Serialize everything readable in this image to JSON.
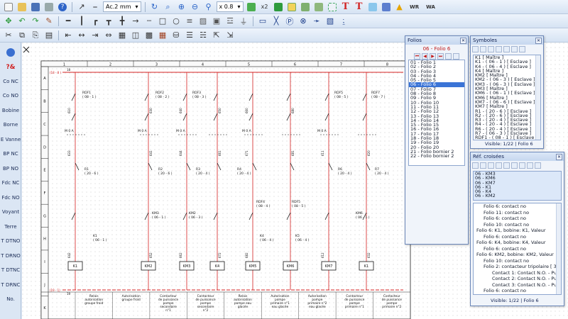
{
  "toolbar": {
    "line_style": "Ac.2 mm",
    "zoom": "x 0.8",
    "wr_badge": "WR",
    "wa_badge": "WA",
    "x2_label": "x2",
    "icons": [
      "new-icon",
      "open-icon",
      "save-icon",
      "print-icon",
      "help-icon",
      "pointer-icon",
      "cross-icon",
      "zoom-icon",
      "text-T-icon",
      "component-icon",
      "wire-icon"
    ]
  },
  "palette": {
    "items": [
      "?&",
      "Co NC",
      "Co NO",
      "Bobine",
      "Borne",
      "E Vanne",
      "BP NC",
      "BP NO",
      "Fdc NC",
      "Fdc NO",
      "Voyant",
      "Terre",
      "T DTNO",
      "T DRNO",
      "T DTNC",
      "T DRNC",
      "No."
    ]
  },
  "schematic": {
    "columns": [
      "1",
      "2",
      "3",
      "4",
      "5",
      "6",
      "7",
      "8"
    ],
    "rows": [
      "A",
      "B",
      "C",
      "D",
      "E",
      "F",
      "G",
      "H",
      "I",
      "J",
      "K"
    ],
    "top_feed": "(18 - 8 )",
    "bottom_feed": "(19 - 1)",
    "wire_top": "18",
    "wire_bottom": "19",
    "moa": [
      "M 0 A",
      "M 0 A",
      "M 0 A",
      "M 0 A",
      "M 0 A"
    ],
    "rdf": [
      "RDF1",
      "( 08 - 1 )",
      "RDF2",
      "( 08 - 2 )",
      "RDF3",
      "( 08 - 3 )",
      "RDF5",
      "( 08 - 5 )",
      "RDF7",
      "( 08 - 7 )"
    ],
    "relays": [
      "R1",
      "( 20 - 6 )",
      "R2",
      "( 20 - 6 )",
      "R3",
      "( 20 - 4 )",
      "R4",
      "( 20 - 4 )",
      "R6",
      "( 20 - 4 )",
      "R7",
      "( 20 - 4 )"
    ],
    "contactors": [
      "KM3",
      "( 06 - 1 )",
      "KM2",
      "( 06 - 3 )",
      "KM6",
      "( 06 - 1 )",
      "K1",
      "( 06 - 1 )",
      "K4",
      "( 06 - 4 )",
      "K5",
      "( 06 - 4 )",
      "RDF4",
      "( 08 - 4 )",
      "RDF5",
      "( 08 - 5 )"
    ],
    "coils": [
      "K1",
      "KM2",
      "KM3",
      "K4",
      "KM5",
      "KM6",
      "KM7"
    ],
    "wire_numbers": [
      "610",
      "630",
      "640",
      "650",
      "660",
      "680",
      "611",
      "620",
      "633",
      "641",
      "644",
      "661",
      "671",
      "681",
      "612",
      "632",
      "642",
      "652",
      "662",
      "672",
      "682"
    ],
    "captions": [
      "Relais autorisation groupe froid",
      "Autorisation groupe froid",
      "Contacteur de puissance pompe secondaire n°1",
      "Contacteur de puissance pompe secondaire n°2",
      "Relais autorisation pompe eau glacée",
      "Autorisation pompe primaire n°1 eau glacée",
      "Autorisation pompe primaire n°2 eau glacée",
      "Contacteur de puissance pompe primaire n°1",
      "Contacteur de puissance pompe primaire n°2"
    ]
  },
  "folios": {
    "title": "Folios",
    "current": "06 - Folio 6",
    "items": [
      "01 - Folio 1",
      "02 - Folio 2",
      "03 - Folio 3",
      "04 - Folio 4",
      "05 - Folio 5",
      "06 - Folio 6",
      "07 - Folio 7",
      "08 - Folio 8",
      "09 - Folio 9",
      "10 - Folio 10",
      "11 - Folio 11",
      "12 - Folio 12",
      "13 - Folio 13",
      "14 - Folio 14",
      "15 - Folio 15",
      "16 - Folio 16",
      "17 - Folio 17",
      "18 - Folio 18",
      "19 - Folio 19",
      "20 - Folio 20",
      "21 - Folio bornier 2",
      "22 - Folio bornier 2"
    ],
    "selected_index": 5
  },
  "symboles": {
    "title": "Symboles",
    "items": [
      "K1 [ Maître ]",
      "K1 - ( 06 - 1 ) [ Esclave ]",
      "K4 - ( 06 - 4 ) [ Esclave ]",
      "K4 [ Maître ]",
      "KM2 [ Maître ]",
      "KM2 - ( 06 - 3 ) [ Esclave ]",
      "KM3 - ( 06 - 3 ) [ Esclave ]",
      "KM3 [ Maître ]",
      "KM6 - ( 06 - 1 ) [ Esclave ]",
      "KM6 [ Maître ]",
      "KM7 - ( 06 - 6 ) [ Esclave ]",
      "KM7 [ Maître ]",
      "R1 - ( 20 - 6 ) [ Esclave ]",
      "R2 - ( 20 - 6 ) [ Esclave ]",
      "R3 - ( 20 - 4 ) [ Esclave ]",
      "R4 - ( 20 - 4 ) [ Esclave ]",
      "R6 - ( 20 - 4 ) [ Esclave ]",
      "R7 - ( 06 - 3 ) [ Esclave ]",
      "RDF1 - ( 08 - 1 ) [ Esclave ]"
    ],
    "status": "Visible: 1/22  |  Folio 6"
  },
  "refs": {
    "title": "Réf. croisées",
    "items": [
      "06 - KM3",
      "06 - KM6",
      "06 - KM7",
      "06 - K1",
      "06 - K4",
      "06 - KM2"
    ],
    "tree": [
      "Folio 6: contact no",
      "Folio 11: contact no",
      "Folio 6: contact no",
      "Folio 10: contact no",
      "Folio 6: K1, bobine: K1, Valeur",
      "Folio 6: contact no",
      "Folio 6: K4, bobine: K4, Valeur",
      "Folio 6: contact no",
      "Folio 6: KM2, bobine: KM2, Valeur",
      "Folio 10: contact no",
      "Folio 2: contacteur tripolaire [ 3 Cont",
      "Contact 1: Contact N.O. - Puissanc",
      "Contact 2: Contact N.O. - Puissanc",
      "Contact 3: Contact N.O. - Puissanc",
      "Folio 6: contact no"
    ],
    "status": "Visible: 1/22  |  Folio 6"
  }
}
